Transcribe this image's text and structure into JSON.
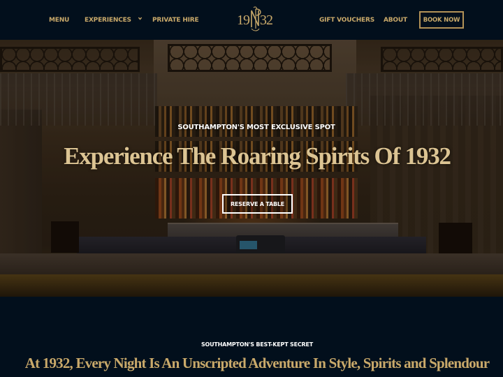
{
  "header": {
    "nav_left": [
      {
        "label": "MENU"
      },
      {
        "label": "EXPERIENCES",
        "has_dropdown": true,
        "dropdown_icon": "chevron-down-icon"
      },
      {
        "label": "PRIVATE HIRE"
      }
    ],
    "logo_text": "19 32",
    "logo_monogram": "NP",
    "nav_right": [
      {
        "label": "GIFT VOUCHERS"
      },
      {
        "label": "ABOUT"
      }
    ],
    "book_button_label": "BOOK NOW"
  },
  "hero": {
    "eyebrow": "SOUTHAMPTON'S MOST EXCLUSIVE SPOT",
    "title": "Experience The Roaring Spirits Of 1932",
    "cta_label": "RESERVE A TABLE",
    "background_image": "bar-interior-photo"
  },
  "intro": {
    "eyebrow": "SOUTHAMPTON'S BEST-KEPT SECRET",
    "title": "At 1932, Every Night Is An Unscripted Adventure In Style, Spirits and Splendour"
  },
  "colors": {
    "background": "#020f1c",
    "gold": "#c9a96a",
    "hero_title": "#dcc493",
    "white": "#ffffff"
  }
}
